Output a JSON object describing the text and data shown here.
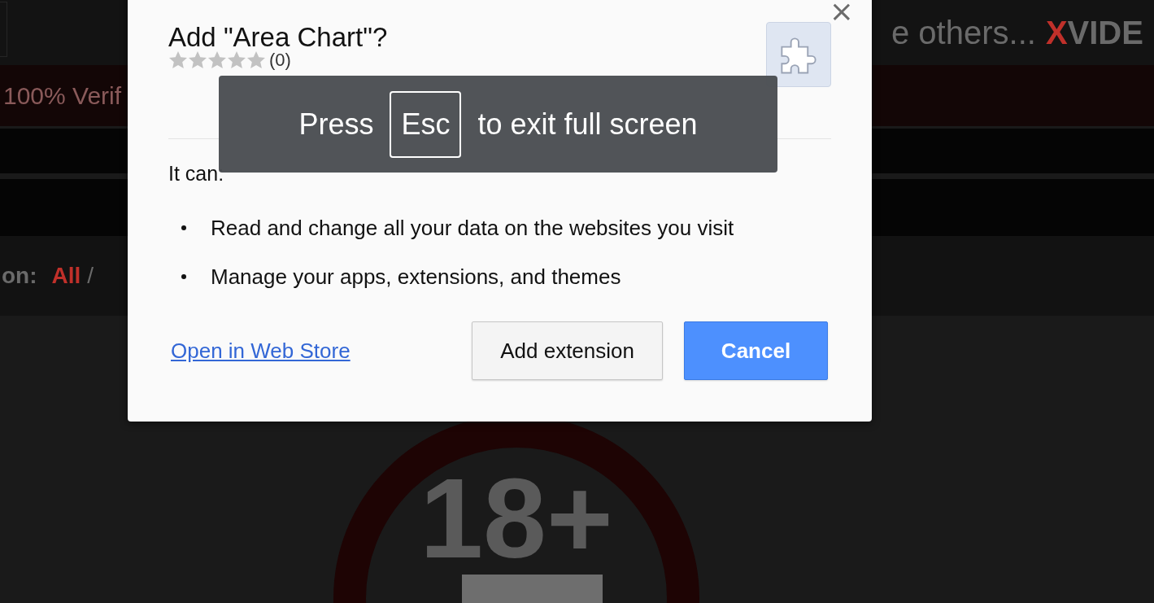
{
  "page": {
    "header_text": "e others...",
    "logo_accent": "X",
    "logo_rest": "VIDE",
    "banner_text": "100% Verif",
    "filter_label": "on:",
    "filter_value": "All",
    "filter_separator": "/",
    "age_badge": "18+"
  },
  "dialog": {
    "close": "×",
    "title": "Add \"Area Chart\"?",
    "stars": 0,
    "rating_count": "(0)",
    "intro": "It can:",
    "permissions": [
      "Read and change all your data on the websites you visit",
      "Manage your apps, extensions, and themes"
    ],
    "link": "Open in Web Store",
    "buttons": [
      {
        "label": "Add extension",
        "primary": false
      },
      {
        "label": "Cancel",
        "primary": true
      }
    ]
  },
  "fullscreen_toast": {
    "before": "Press",
    "key": "Esc",
    "after": "to exit full screen"
  }
}
